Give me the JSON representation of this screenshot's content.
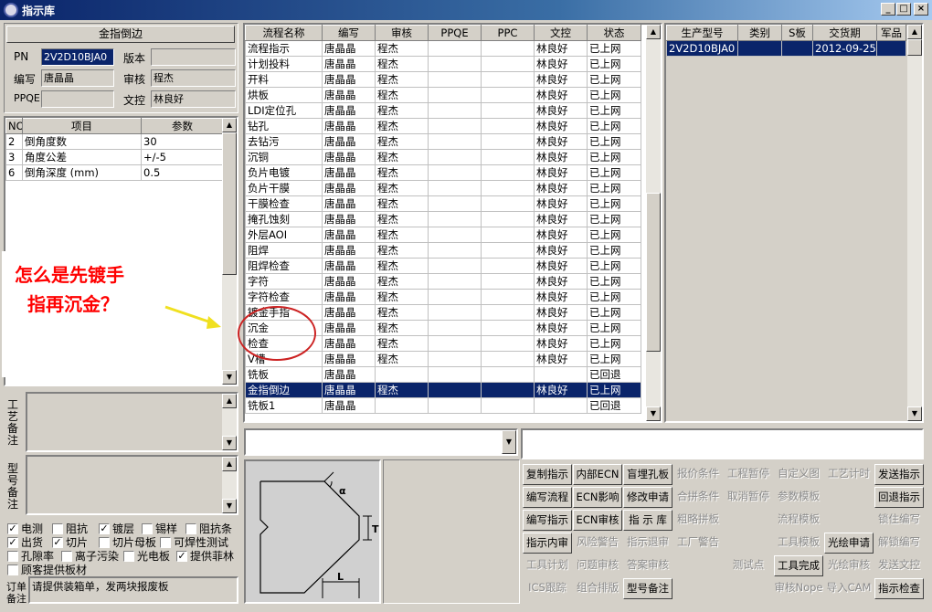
{
  "window": {
    "title": "指示库",
    "btn_min": "_",
    "btn_max": "□",
    "btn_close": "×"
  },
  "left": {
    "header": "金指倒边",
    "pn_label": "PN",
    "pn_value": "2V2D10BJA0",
    "version_label": "版本",
    "version_value": "",
    "author_label": "编写",
    "author_value": "唐晶晶",
    "review_label": "审核",
    "review_value": "程杰",
    "ppqe_label": "PPQE",
    "ppqe_value": "",
    "doc_label": "文控",
    "doc_value": "林良好",
    "params": {
      "headers": [
        "NO",
        "项目",
        "参数"
      ],
      "rows": [
        [
          "2",
          "倒角度数",
          "30"
        ],
        [
          "3",
          "角度公差",
          "+/-5"
        ],
        [
          "6",
          "倒角深度 (mm)",
          "0.5"
        ]
      ]
    },
    "note_craft": "工艺备注",
    "note_model": "型号备注",
    "checkboxes": [
      {
        "label": "电测",
        "checked": true
      },
      {
        "label": "阻抗",
        "checked": false
      },
      {
        "label": "镀层",
        "checked": true
      },
      {
        "label": "锡样",
        "checked": false
      },
      {
        "label": "阻抗条",
        "checked": false
      },
      {
        "label": "出货",
        "checked": true
      },
      {
        "label": "切片",
        "checked": true
      },
      {
        "label": "切片母板",
        "checked": false
      },
      {
        "label": "可焊性测试",
        "checked": false
      },
      {
        "label": "孔隙率",
        "checked": false
      },
      {
        "label": "离子污染",
        "checked": false
      },
      {
        "label": "光电板",
        "checked": false
      },
      {
        "label": "提供菲林",
        "checked": true
      },
      {
        "label": "顾客提供板材",
        "checked": false
      }
    ],
    "order_label": "订单备注",
    "order_note": "请提供装箱单，发两块报废板"
  },
  "annotation": {
    "text_line1": "怎么是先镀手",
    "text_line2": "指再沉金？",
    "color": "#ff0000",
    "arrow_color": "#f0e020"
  },
  "flow": {
    "headers": [
      "流程名称",
      "编写",
      "审核",
      "PPQE",
      "PPC",
      "文控",
      "状态"
    ],
    "rows": [
      [
        "流程指示",
        "唐晶晶",
        "程杰",
        "",
        "",
        "林良好",
        "已上网"
      ],
      [
        "计划投料",
        "唐晶晶",
        "程杰",
        "",
        "",
        "林良好",
        "已上网"
      ],
      [
        "开料",
        "唐晶晶",
        "程杰",
        "",
        "",
        "林良好",
        "已上网"
      ],
      [
        "烘板",
        "唐晶晶",
        "程杰",
        "",
        "",
        "林良好",
        "已上网"
      ],
      [
        "LDI定位孔",
        "唐晶晶",
        "程杰",
        "",
        "",
        "林良好",
        "已上网"
      ],
      [
        "钻孔",
        "唐晶晶",
        "程杰",
        "",
        "",
        "林良好",
        "已上网"
      ],
      [
        "去钻污",
        "唐晶晶",
        "程杰",
        "",
        "",
        "林良好",
        "已上网"
      ],
      [
        "沉铜",
        "唐晶晶",
        "程杰",
        "",
        "",
        "林良好",
        "已上网"
      ],
      [
        "负片电镀",
        "唐晶晶",
        "程杰",
        "",
        "",
        "林良好",
        "已上网"
      ],
      [
        "负片干膜",
        "唐晶晶",
        "程杰",
        "",
        "",
        "林良好",
        "已上网"
      ],
      [
        "干膜检查",
        "唐晶晶",
        "程杰",
        "",
        "",
        "林良好",
        "已上网"
      ],
      [
        "掩孔蚀刻",
        "唐晶晶",
        "程杰",
        "",
        "",
        "林良好",
        "已上网"
      ],
      [
        "外层AOI",
        "唐晶晶",
        "程杰",
        "",
        "",
        "林良好",
        "已上网"
      ],
      [
        "阻焊",
        "唐晶晶",
        "程杰",
        "",
        "",
        "林良好",
        "已上网"
      ],
      [
        "阻焊检查",
        "唐晶晶",
        "程杰",
        "",
        "",
        "林良好",
        "已上网"
      ],
      [
        "字符",
        "唐晶晶",
        "程杰",
        "",
        "",
        "林良好",
        "已上网"
      ],
      [
        "字符检查",
        "唐晶晶",
        "程杰",
        "",
        "",
        "林良好",
        "已上网"
      ],
      [
        "镀金手指",
        "唐晶晶",
        "程杰",
        "",
        "",
        "林良好",
        "已上网"
      ],
      [
        "沉金",
        "唐晶晶",
        "程杰",
        "",
        "",
        "林良好",
        "已上网"
      ],
      [
        "检查",
        "唐晶晶",
        "程杰",
        "",
        "",
        "林良好",
        "已上网"
      ],
      [
        "V槽",
        "唐晶晶",
        "程杰",
        "",
        "",
        "林良好",
        "已上网"
      ],
      [
        "铣板",
        "唐晶晶",
        "",
        "",
        "",
        "",
        "已回退"
      ],
      [
        "金指倒边",
        "唐晶晶",
        "程杰",
        "",
        "",
        "林良好",
        "已上网"
      ],
      [
        "铣板1",
        "唐晶晶",
        "",
        "",
        "",
        "",
        "已回退"
      ]
    ],
    "selected_index": 22
  },
  "prod": {
    "headers": [
      "生产型号",
      "类别",
      "S板",
      "交货期",
      "军品"
    ],
    "rows": [
      [
        "2V2D10BJA0",
        "",
        "",
        "2012-09-25",
        ""
      ]
    ]
  },
  "diagram": {
    "alpha": "α",
    "t": "T",
    "l": "L"
  },
  "buttons": [
    [
      "复制指示",
      "内部ECN",
      "盲埋孔板",
      "报价条件",
      "工程暂停",
      "自定义图",
      "工艺计时",
      "发送指示"
    ],
    [
      "编写流程",
      "ECN影响",
      "修改申请",
      "合拼条件",
      "取消暂停",
      "参数模板",
      "",
      "回退指示"
    ],
    [
      "编写指示",
      "ECN审核",
      "指 示 库",
      "粗略拼板",
      "",
      "流程模板",
      "",
      "锁住编写"
    ],
    [
      "指示内审",
      "风险警告",
      "指示退审",
      "工厂警告",
      "",
      "工具模板",
      "光绘申请",
      "解锁编写"
    ],
    [
      "工具计划",
      "问题审核",
      "答案审核",
      "",
      "测试点",
      "工具完成",
      "光绘审核",
      "发送文控"
    ],
    [
      "ICS跟踪",
      "组合排版",
      "型号备注",
      "",
      "",
      "审核Nope",
      "导入CAM",
      "指示检查"
    ]
  ],
  "buttons_enabled": [
    [
      true,
      true,
      true,
      false,
      false,
      false,
      false,
      true
    ],
    [
      true,
      true,
      true,
      false,
      false,
      false,
      false,
      true
    ],
    [
      true,
      true,
      true,
      false,
      false,
      false,
      false,
      false
    ],
    [
      true,
      false,
      false,
      false,
      false,
      false,
      true,
      false
    ],
    [
      false,
      false,
      false,
      false,
      false,
      true,
      false,
      false
    ],
    [
      false,
      false,
      true,
      false,
      false,
      false,
      false,
      true
    ]
  ]
}
